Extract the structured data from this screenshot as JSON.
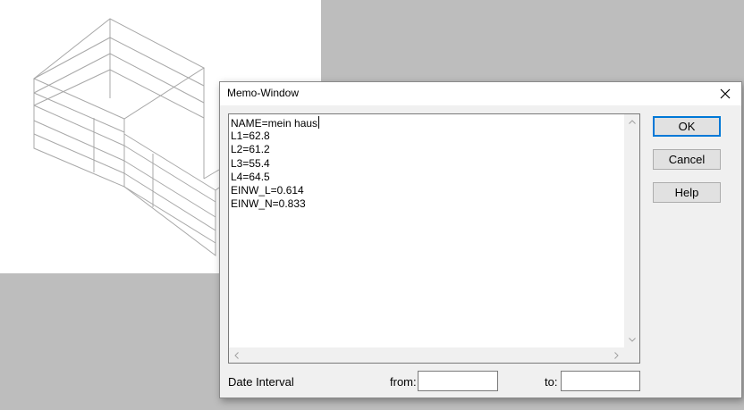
{
  "dialog": {
    "title": "Memo-Window",
    "memo_lines": [
      "NAME=mein haus",
      "L1=62.8",
      "L2=61.2",
      "L3=55.4",
      "L4=64.5",
      "EINW_L=0.614",
      "EINW_N=0.833"
    ],
    "buttons": {
      "ok": "OK",
      "cancel": "Cancel",
      "help": "Help"
    },
    "date_interval": {
      "label": "Date Interval",
      "from_label": "from:",
      "from_value": "",
      "to_label": "to:",
      "to_value": ""
    }
  },
  "icons": {
    "close": "close-icon",
    "scroll_up": "arrow-up-icon",
    "scroll_down": "arrow-down-icon",
    "scroll_left": "arrow-left-icon",
    "scroll_right": "arrow-right-icon"
  },
  "colors": {
    "desktop": "#bdbdbd",
    "dialog_bg": "#f0f0f0",
    "focus_accent": "#0078d7",
    "wireframe": "#9a9a9a"
  }
}
